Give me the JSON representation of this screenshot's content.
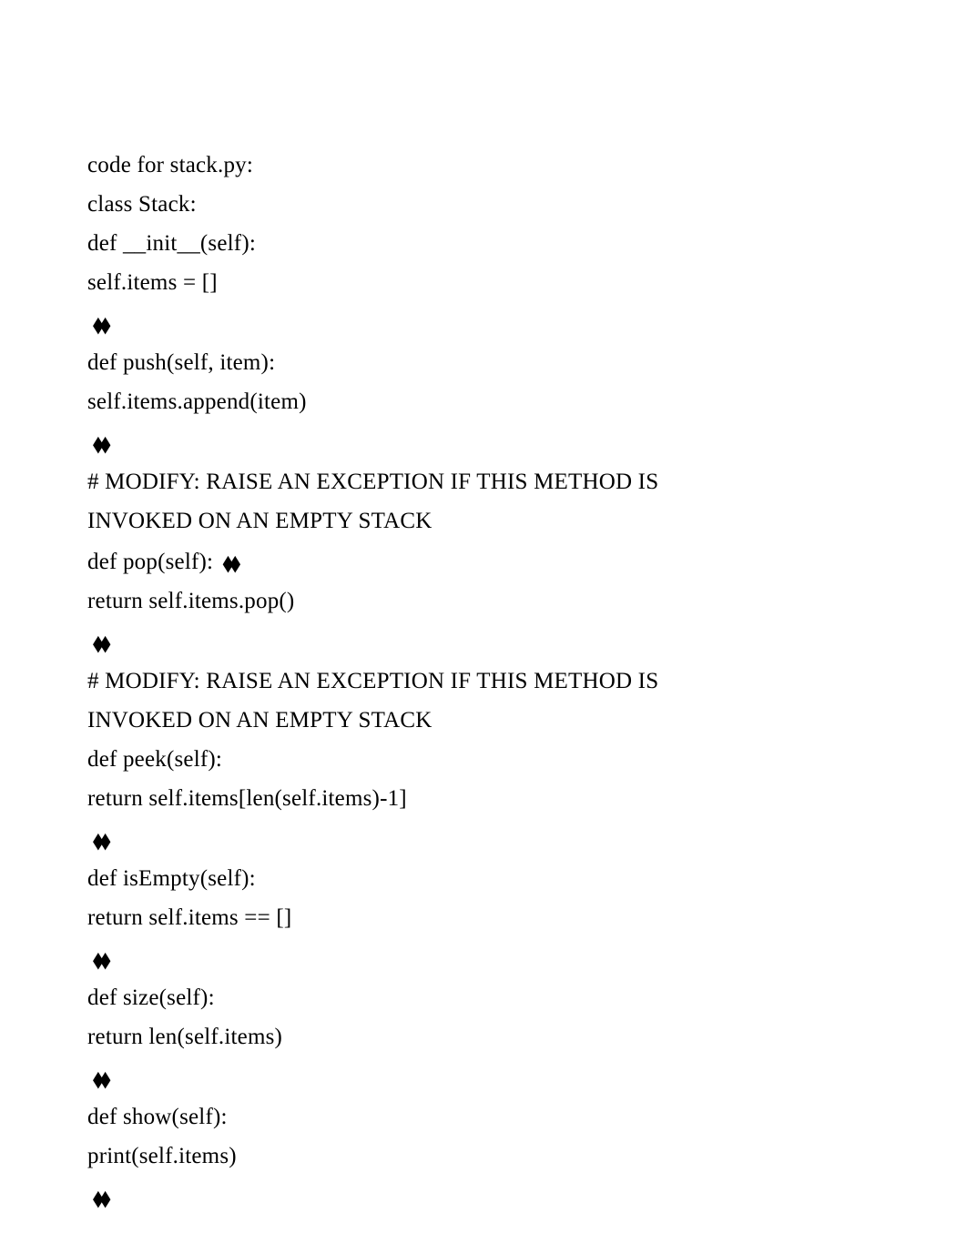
{
  "lines": {
    "l1": "code for stack.py:",
    "l2": "class Stack:",
    "l3": " def __init__(self):",
    "l4": " self.items = []",
    "d1": " ⬧⬧",
    "l5": " def push(self, item):",
    "l6": " self.items.append(item)",
    "d2": " ⬧⬧",
    "l7a": " # MODIFY: RAISE AN EXCEPTION IF THIS METHOD IS",
    "l7b": "INVOKED ON AN EMPTY STACK",
    "l8a": " def pop(self): ",
    "l8b": "⬧⬧",
    "l9": " return self.items.pop()",
    "d3": " ⬧⬧",
    "l10a": " # MODIFY: RAISE AN EXCEPTION IF THIS METHOD IS",
    "l10b": "INVOKED ON AN EMPTY STACK",
    "l11": " def peek(self):",
    "l12": " return self.items[len(self.items)-1]",
    "d4": " ⬧⬧",
    "l13": " def isEmpty(self):",
    "l14": " return self.items == []",
    "d5": " ⬧⬧",
    "l15": " def size(self):",
    "l16": " return len(self.items)",
    "d6": " ⬧⬧",
    "l17": " def show(self):",
    "l18": " print(self.items)",
    "d7": " ⬧⬧"
  }
}
